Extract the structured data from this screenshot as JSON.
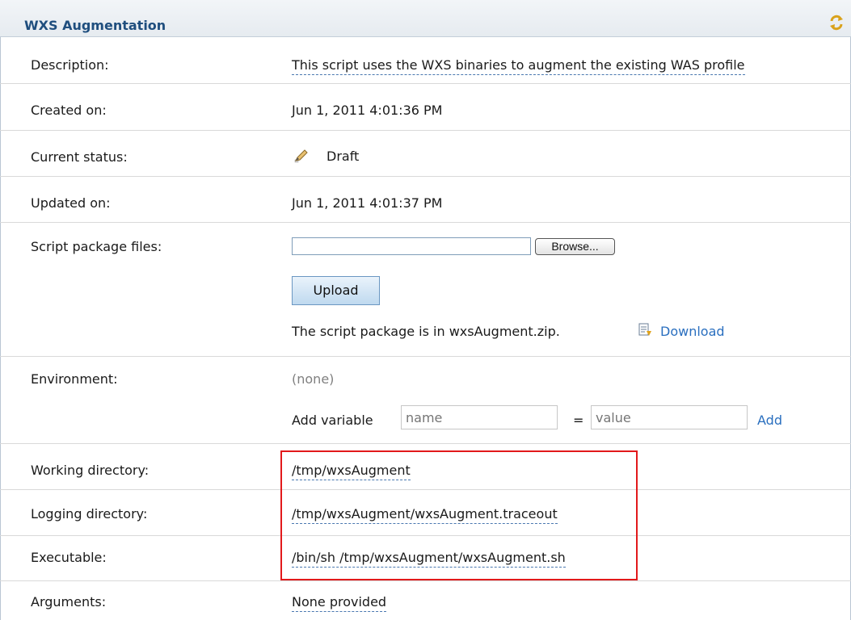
{
  "panel": {
    "title": "WXS Augmentation",
    "refresh_icon": "refresh-arrows-icon",
    "accent_color": "#1f4e7e",
    "highlight_color": "#e2191b"
  },
  "fields": {
    "description": {
      "label": "Description:",
      "value": "This script uses the WXS binaries to augment the existing WAS profile"
    },
    "created_on": {
      "label": "Created on:",
      "value": "Jun 1, 2011 4:01:36 PM"
    },
    "current_status": {
      "label": "Current status:",
      "value": "Draft",
      "icon": "pencil-icon"
    },
    "updated_on": {
      "label": "Updated on:",
      "value": "Jun 1, 2011 4:01:37 PM"
    },
    "script_package_files": {
      "label": "Script package files:",
      "file_value": "",
      "browse_label": "Browse...",
      "upload_label": "Upload",
      "package_text": "The script package is in wxsAugment.zip.",
      "download_icon": "download-icon",
      "download_label": "Download"
    },
    "environment": {
      "label": "Environment:",
      "value": "(none)",
      "add_variable_label": "Add variable",
      "name_placeholder": "name",
      "equals": "=",
      "value_placeholder": "value",
      "add_label": "Add"
    },
    "working_directory": {
      "label": "Working directory:",
      "value": "/tmp/wxsAugment"
    },
    "logging_directory": {
      "label": "Logging directory:",
      "value": "/tmp/wxsAugment/wxsAugment.traceout"
    },
    "executable": {
      "label": "Executable:",
      "value": "/bin/sh /tmp/wxsAugment/wxsAugment.sh"
    },
    "arguments": {
      "label": "Arguments:",
      "value": "None provided"
    }
  }
}
